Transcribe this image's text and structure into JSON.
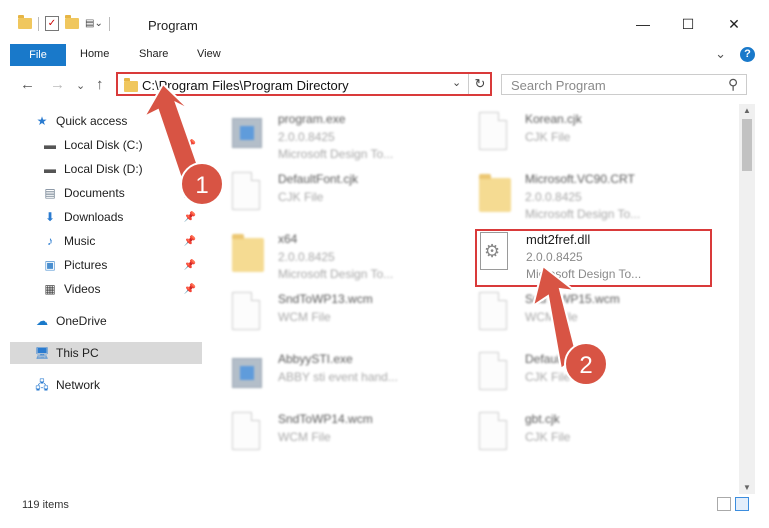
{
  "window": {
    "title": "Program",
    "minimize": "—",
    "maximize": "☐",
    "close": "✕"
  },
  "ribbon": {
    "tabs": [
      "File",
      "Home",
      "Share",
      "View"
    ],
    "expand": "⌄",
    "help": "?"
  },
  "nav": {
    "back": "←",
    "forward": "→",
    "recent": "⌄",
    "up": "↑"
  },
  "address": {
    "path": "C:\\Program Files\\Program Directory",
    "dropdown": "⌄",
    "refresh": "↻"
  },
  "search": {
    "placeholder": "Search Program",
    "icon": "⚲"
  },
  "sidebar": {
    "items": [
      {
        "label": "Quick access",
        "icon": "star-icon",
        "pinned": false
      },
      {
        "label": "Local Disk (C:)",
        "icon": "drive-icon",
        "pinned": true
      },
      {
        "label": "Local Disk (D:)",
        "icon": "drive-icon",
        "pinned": true
      },
      {
        "label": "Documents",
        "icon": "document-icon",
        "pinned": true
      },
      {
        "label": "Downloads",
        "icon": "download-icon",
        "pinned": true
      },
      {
        "label": "Music",
        "icon": "music-icon",
        "pinned": true
      },
      {
        "label": "Pictures",
        "icon": "picture-icon",
        "pinned": true
      },
      {
        "label": "Videos",
        "icon": "video-icon",
        "pinned": true
      },
      {
        "label": "OneDrive",
        "icon": "cloud-icon",
        "pinned": false
      },
      {
        "label": "This PC",
        "icon": "computer-icon",
        "pinned": false,
        "selected": true
      },
      {
        "label": "Network",
        "icon": "network-icon",
        "pinned": false
      }
    ]
  },
  "files": [
    {
      "name": "program.exe",
      "line1": "2.0.0.8425",
      "line2": "Microsoft Design To...",
      "icon": "exe-icon",
      "blurred": true
    },
    {
      "name": "Korean.cjk",
      "line1": "CJK File",
      "line2": "",
      "icon": "file-icon",
      "blurred": true
    },
    {
      "name": "DefaultFont.cjk",
      "line1": "CJK File",
      "line2": "",
      "icon": "file-icon",
      "blurred": true
    },
    {
      "name": "Microsoft.VC90.CRT",
      "line1": "2.0.0.8425",
      "line2": "Microsoft Design To...",
      "icon": "folder-icon",
      "blurred": true
    },
    {
      "name": "x64",
      "line1": "2.0.0.8425",
      "line2": "Microsoft Design To...",
      "icon": "folder-icon",
      "blurred": true
    },
    {
      "name": "mdt2fref.dll",
      "line1": "2.0.0.8425",
      "line2": "Microsoft Design To...",
      "icon": "dll-icon",
      "blurred": false
    },
    {
      "name": "SndToWP13.wcm",
      "line1": "WCM File",
      "line2": "",
      "icon": "file-icon",
      "blurred": true
    },
    {
      "name": "SndToWP15.wcm",
      "line1": "WCM File",
      "line2": "",
      "icon": "file-icon",
      "blurred": true
    },
    {
      "name": "AbbyySTI.exe",
      "line1": "ABBY sti event hand...",
      "line2": "",
      "icon": "exe-icon",
      "blurred": true
    },
    {
      "name": "Default.cjk",
      "line1": "CJK File",
      "line2": "",
      "icon": "file-icon",
      "blurred": true
    },
    {
      "name": "SndToWP14.wcm",
      "line1": "WCM File",
      "line2": "",
      "icon": "file-icon",
      "blurred": true
    },
    {
      "name": "gbt.cjk",
      "line1": "CJK File",
      "line2": "",
      "icon": "file-icon",
      "blurred": true
    }
  ],
  "status": {
    "items": "119 items"
  },
  "annotations": {
    "badge1": "1",
    "badge2": "2",
    "color": "#d85444"
  }
}
